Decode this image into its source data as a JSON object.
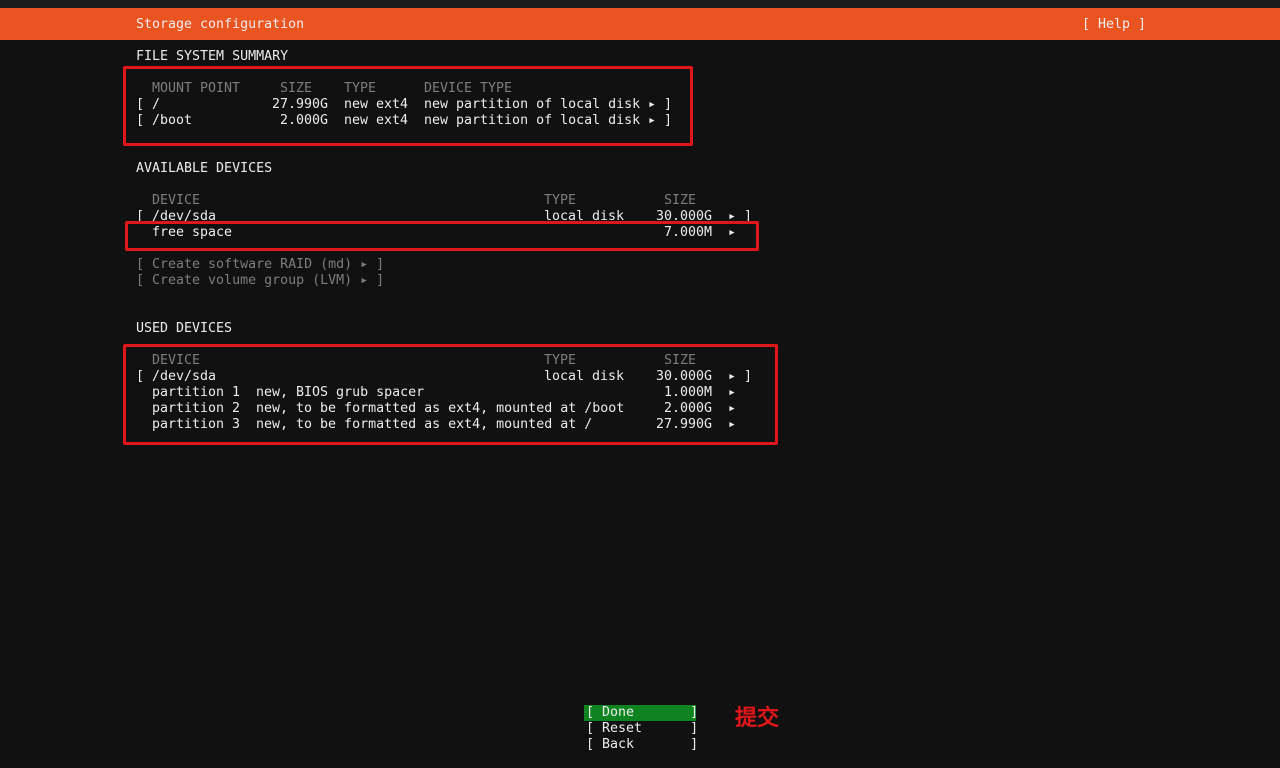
{
  "header": {
    "title": "Storage configuration",
    "help": "[ Help ]"
  },
  "fs_summary": {
    "heading": "FILE SYSTEM SUMMARY",
    "col_mount": "MOUNT POINT",
    "col_size": "SIZE",
    "col_type": "TYPE",
    "col_devtype": "DEVICE TYPE",
    "rows": [
      {
        "open": "[",
        "mount": "/",
        "size": "27.990G",
        "type": "new ext4",
        "devtype": "new partition of local disk",
        "arrow": "▸",
        "close": "]"
      },
      {
        "open": "[",
        "mount": "/boot",
        "size": "2.000G",
        "type": "new ext4",
        "devtype": "new partition of local disk",
        "arrow": "▸",
        "close": "]"
      }
    ]
  },
  "available": {
    "heading": "AVAILABLE DEVICES",
    "col_device": "DEVICE",
    "col_type": "TYPE",
    "col_size": "SIZE",
    "disk": {
      "open": "[",
      "name": "/dev/sda",
      "type": "local disk",
      "size": "30.000G",
      "arrow": "▸",
      "close": "]"
    },
    "free": {
      "name": "free space",
      "size": "7.000M",
      "arrow": "▸"
    },
    "raid": "[ Create software RAID (md) ▸ ]",
    "lvm": "[ Create volume group (LVM) ▸ ]"
  },
  "used": {
    "heading": "USED DEVICES",
    "col_device": "DEVICE",
    "col_type": "TYPE",
    "col_size": "SIZE",
    "disk": {
      "open": "[",
      "name": "/dev/sda",
      "type": "local disk",
      "size": "30.000G",
      "arrow": "▸",
      "close": "]"
    },
    "partitions": [
      {
        "name": "partition 1",
        "desc": "new, BIOS grub spacer",
        "size": "1.000M",
        "arrow": "▸"
      },
      {
        "name": "partition 2",
        "desc": "new, to be formatted as ext4, mounted at /boot",
        "size": "2.000G",
        "arrow": "▸"
      },
      {
        "name": "partition 3",
        "desc": "new, to be formatted as ext4, mounted at /",
        "size": "27.990G",
        "arrow": "▸"
      }
    ]
  },
  "buttons": {
    "done": "[ Done       ]",
    "reset": "[ Reset      ]",
    "back": "[ Back       ]"
  },
  "annotation": {
    "submit_label": "提交",
    "color": "#e0161b"
  },
  "colors": {
    "header": "#e95420",
    "focus": "#0e8420",
    "background": "#111111"
  }
}
